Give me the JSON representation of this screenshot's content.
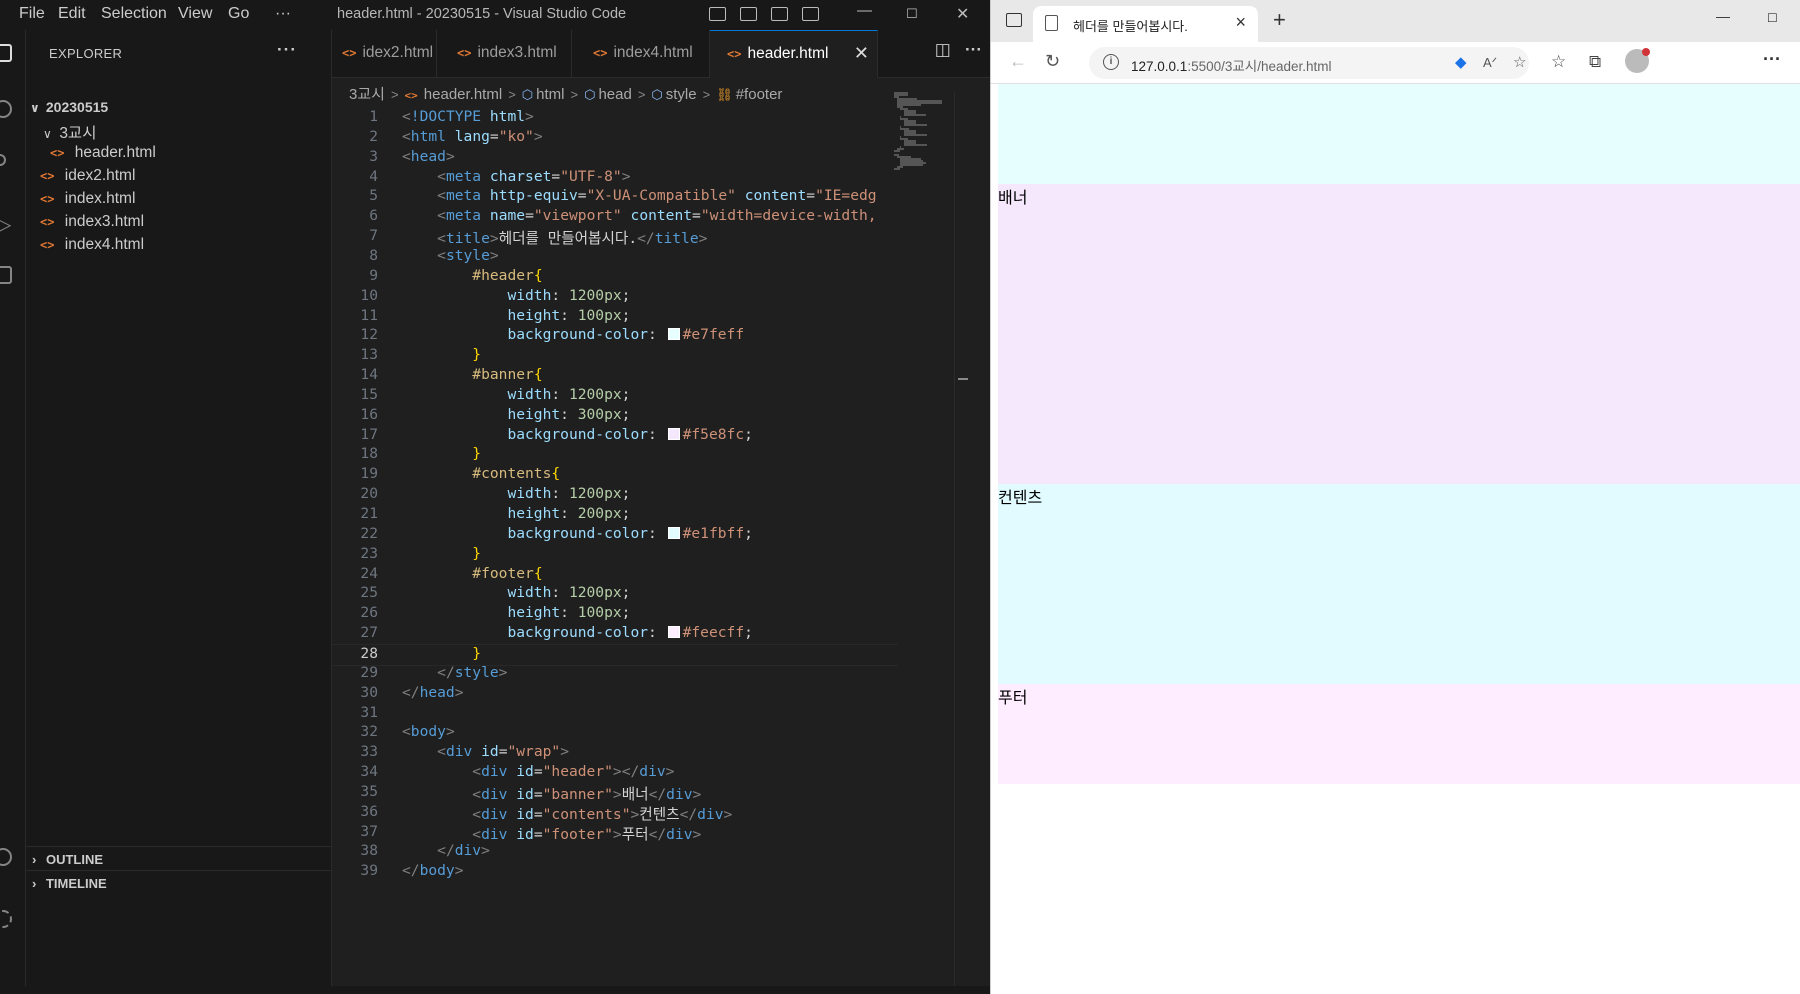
{
  "vscode": {
    "menu": [
      "File",
      "Edit",
      "Selection",
      "View",
      "Go",
      "···"
    ],
    "window_title": "header.html - 20230515 - Visual Studio Code",
    "explorer": {
      "title": "EXPLORER",
      "root": "20230515",
      "folder": "3교시",
      "folder_files": [
        "header.html"
      ],
      "files": [
        "idex2.html",
        "index.html",
        "index3.html",
        "index4.html"
      ]
    },
    "panels": [
      "OUTLINE",
      "TIMELINE"
    ],
    "tabs": [
      "idex2.html",
      "index3.html",
      "index4.html",
      "header.html"
    ],
    "active_tab": "header.html",
    "breadcrumb": [
      "3교시",
      "header.html",
      "html",
      "head",
      "style",
      "#footer"
    ],
    "current_line": 28,
    "code_lines": [
      "<!DOCTYPE html>",
      "<html lang=\"ko\">",
      "<head>",
      "    <meta charset=\"UTF-8\">",
      "    <meta http-equiv=\"X-UA-Compatible\" content=\"IE=edg",
      "    <meta name=\"viewport\" content=\"width=device-width,",
      "    <title>헤더를 만들어봅시다.</title>",
      "    <style>",
      "        #header{",
      "            width: 1200px;",
      "            height: 100px;",
      "            background-color: #e7feff",
      "        }",
      "        #banner{",
      "            width: 1200px;",
      "            height: 300px;",
      "            background-color: #f5e8fc;",
      "        }",
      "        #contents{",
      "            width: 1200px;",
      "            height: 200px;",
      "            background-color: #e1fbff;",
      "        }",
      "        #footer{",
      "            width: 1200px;",
      "            height: 100px;",
      "            background-color: #feecff;",
      "        }",
      "    </style>",
      "</head>",
      "",
      "<body>",
      "    <div id=\"wrap\">",
      "        <div id=\"header\"></div>",
      "        <div id=\"banner\">배너</div>",
      "        <div id=\"contents\">컨텐츠</div>",
      "        <div id=\"footer\">푸터</div>",
      "    </div>",
      "</body>"
    ]
  },
  "browser": {
    "tab_title": "헤더를 만들어봅시다.",
    "url_host": "127.0.0.1",
    "url_rest": ":5500/3교시/header.html",
    "page": {
      "header": {
        "text": "",
        "color": "#e7feff"
      },
      "banner": {
        "text": "배너",
        "color": "#f5e8fc"
      },
      "contents": {
        "text": "컨텐츠",
        "color": "#e1fbff"
      },
      "footer": {
        "text": "푸터",
        "color": "#feecff"
      }
    }
  }
}
